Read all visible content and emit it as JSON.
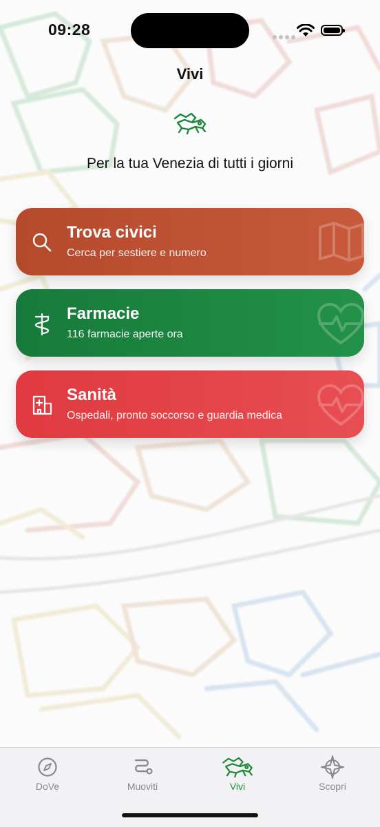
{
  "status_bar": {
    "time": "09:28"
  },
  "header": {
    "title": "Vivi",
    "tagline": "Per la tua Venezia di tutti i giorni",
    "logo_icon": "venice-lion-icon"
  },
  "cards": [
    {
      "title": "Trova civici",
      "subtitle": "Cerca per sestiere e numero",
      "icon": "search-icon",
      "watermark": "map-icon",
      "color": "#c0503a"
    },
    {
      "title": "Farmacie",
      "subtitle": "116 farmacie aperte ora",
      "icon": "caduceus-icon",
      "watermark": "heart-pulse-icon",
      "color": "#1e8640"
    },
    {
      "title": "Sanità",
      "subtitle": "Ospedali, pronto soccorso e guardia medica",
      "icon": "hospital-icon",
      "watermark": "heart-pulse-icon",
      "color": "#e3454a"
    }
  ],
  "tabs": [
    {
      "label": "DoVe",
      "icon": "compass-icon",
      "active": false
    },
    {
      "label": "Muoviti",
      "icon": "route-icon",
      "active": false
    },
    {
      "label": "Vivi",
      "icon": "venice-lion-icon",
      "active": true
    },
    {
      "label": "Scopri",
      "icon": "compass-rose-icon",
      "active": false
    }
  ],
  "colors": {
    "accent": "#1f8a3e",
    "inactive": "#8a8a8e"
  }
}
